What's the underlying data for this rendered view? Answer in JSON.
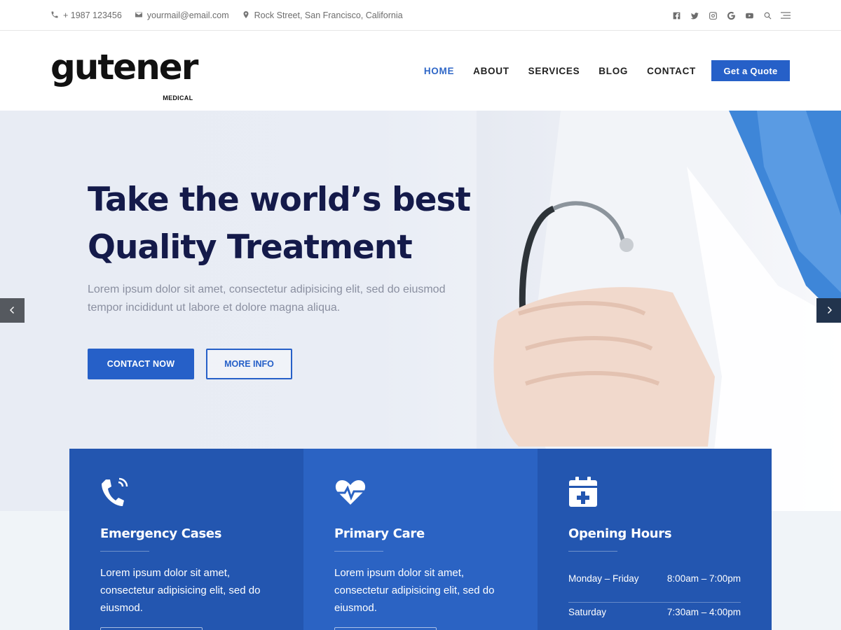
{
  "topbar": {
    "phone": "+ 1987 123456",
    "email": "yourmail@email.com",
    "address": "Rock Street, San Francisco, California",
    "social": [
      "facebook-icon",
      "twitter-icon",
      "instagram-icon",
      "google-icon",
      "youtube-icon",
      "search-icon",
      "menu-icon"
    ]
  },
  "header": {
    "logo_word": "gutener",
    "logo_sub": "MEDICAL",
    "nav": [
      "HOME",
      "ABOUT",
      "SERVICES",
      "BLOG",
      "CONTACT"
    ],
    "active_nav": "HOME",
    "quote_button": "Get a Quote"
  },
  "hero": {
    "title_line1": "Take the world’s best",
    "title_line2": "Quality Treatment",
    "text": "Lorem ipsum dolor sit amet, consectetur adipisicing elit, sed do eiusmod tempor incididunt ut labore et dolore magna aliqua.",
    "primary_button": "CONTACT NOW",
    "secondary_button": "MORE INFO"
  },
  "features": {
    "emergency": {
      "icon": "phone-icon",
      "title": "Emergency Cases",
      "text": "Lorem ipsum dolor sit amet, consectetur adipisicing elit, sed do eiusmod."
    },
    "primary": {
      "icon": "heartbeat-icon",
      "title": "Primary Care",
      "text": "Lorem ipsum dolor sit amet, consectetur adipisicing elit, sed do eiusmod."
    },
    "hours": {
      "icon": "calendar-plus-icon",
      "title": "Opening Hours",
      "rows": [
        {
          "day": "Monday – Friday",
          "time": "8:00am – 7:00pm"
        },
        {
          "day": "Saturday",
          "time": "7:30am – 4:00pm"
        }
      ]
    }
  },
  "colors": {
    "accent": "#2660c8",
    "heading": "#141a4a",
    "feature_dark": "#2356b0",
    "feature_mid": "#2b63c3"
  }
}
